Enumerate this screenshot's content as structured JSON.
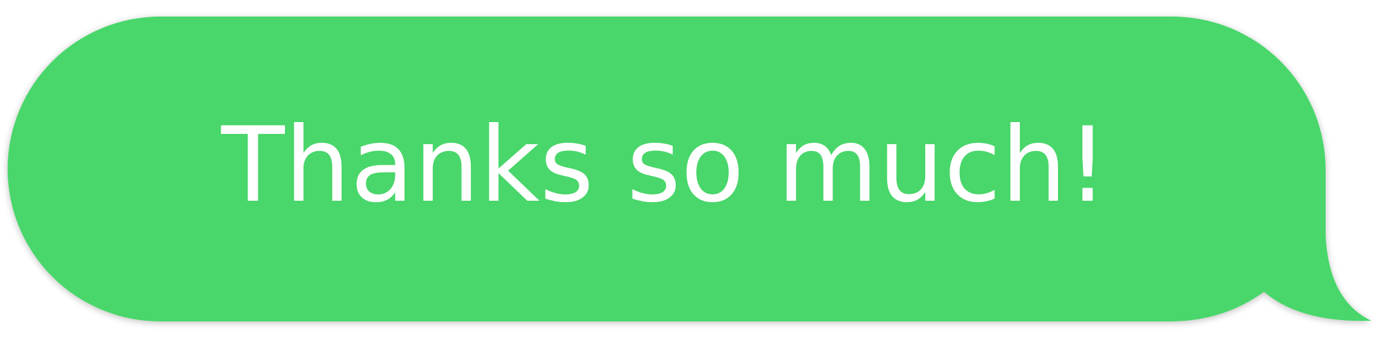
{
  "message": {
    "text": "Thanks so much!"
  },
  "colors": {
    "bubble": "#4AD66A",
    "text": "#FFFFFF"
  }
}
